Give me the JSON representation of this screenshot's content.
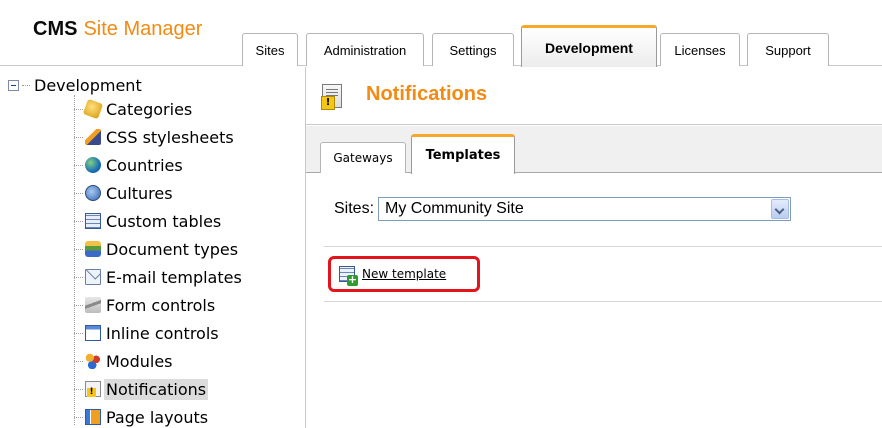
{
  "app": {
    "logo_bold": "CMS",
    "logo_rest": "Site Manager"
  },
  "top_tabs": [
    {
      "label": "Sites",
      "active": false
    },
    {
      "label": "Administration",
      "active": false
    },
    {
      "label": "Settings",
      "active": false
    },
    {
      "label": "Development",
      "active": true
    },
    {
      "label": "Licenses",
      "active": false
    },
    {
      "label": "Support",
      "active": false
    }
  ],
  "tree": {
    "root_label": "Development",
    "items": [
      {
        "label": "Categories",
        "icon": "categories-icon",
        "selected": false
      },
      {
        "label": "CSS stylesheets",
        "icon": "css-stylesheets-icon",
        "selected": false
      },
      {
        "label": "Countries",
        "icon": "globe-icon",
        "selected": false
      },
      {
        "label": "Cultures",
        "icon": "cultures-globe-icon",
        "selected": false
      },
      {
        "label": "Custom tables",
        "icon": "table-icon",
        "selected": false
      },
      {
        "label": "Document types",
        "icon": "document-types-icon",
        "selected": false
      },
      {
        "label": "E-mail templates",
        "icon": "envelope-icon",
        "selected": false
      },
      {
        "label": "Form controls",
        "icon": "form-controls-icon",
        "selected": false
      },
      {
        "label": "Inline controls",
        "icon": "inline-controls-icon",
        "selected": false
      },
      {
        "label": "Modules",
        "icon": "modules-icon",
        "selected": false
      },
      {
        "label": "Notifications",
        "icon": "notification-icon",
        "selected": true
      },
      {
        "label": "Page layouts",
        "icon": "page-layouts-icon",
        "selected": false
      }
    ]
  },
  "main": {
    "title": "Notifications",
    "title_icon": "notification-icon",
    "subtabs": [
      {
        "label": "Gateways",
        "active": false
      },
      {
        "label": "Templates",
        "active": true
      }
    ],
    "sites_label": "Sites:",
    "sites_selected": "My Community Site",
    "new_template_label": "New template",
    "highlight_color": "#e3141b"
  },
  "colors": {
    "brand_orange": "#f28a13",
    "active_tab_accent": "#f7a82a"
  }
}
